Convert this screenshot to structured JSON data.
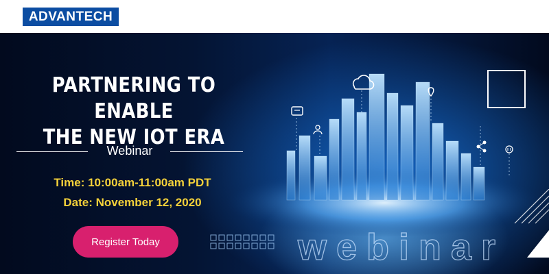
{
  "brand": {
    "logo_text": "ADVANTECH"
  },
  "hero": {
    "headline_line1": "PARTNERING TO ENABLE",
    "headline_line2": "THE NEW IOT ERA",
    "event_type": "Webinar",
    "time": "Time: 10:00am-11:00am PDT",
    "date": "Date: November 12, 2020",
    "register_label": "Register Today",
    "watermark": "webinar"
  },
  "colors": {
    "brand_blue": "#0c4da2",
    "highlight_yellow": "#f5d23a",
    "cta_pink": "#d8206e",
    "background_navy": "#041433"
  },
  "icons": [
    "cloud-icon",
    "chat-icon",
    "users-icon",
    "location-pin-icon",
    "share-icon",
    "plug-icon"
  ]
}
